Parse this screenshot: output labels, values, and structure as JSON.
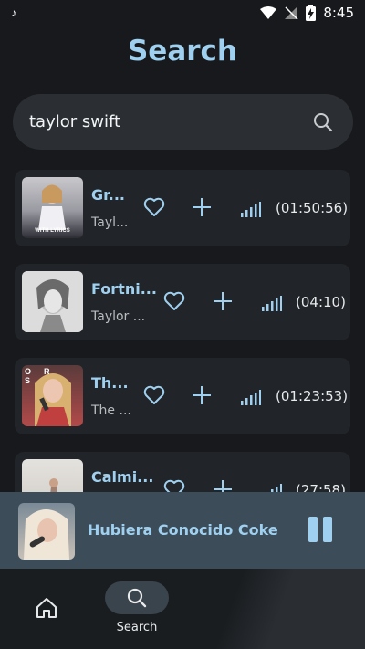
{
  "status": {
    "left_icon": "music-note-icon",
    "time": "8:45"
  },
  "page": {
    "title": "Search"
  },
  "search": {
    "value": "taylor swift"
  },
  "results": [
    {
      "title": "Gr...",
      "artist": "Tayl...",
      "duration": "(01:50:56)",
      "thumb_caption": "WITH LYRICS"
    },
    {
      "title": "Fortni...",
      "artist": "Taylor ...",
      "duration": "(04:10)"
    },
    {
      "title": "Th...",
      "artist": "The ...",
      "duration": "(01:23:53)",
      "thumb_caption": "OR S"
    },
    {
      "title": "Calmi...",
      "artist": "",
      "duration": "(27:58)"
    }
  ],
  "player": {
    "title": "Hubiera Conocido  Coke"
  },
  "nav": {
    "search_label": "Search"
  },
  "colors": {
    "accent": "#9fd0ef",
    "background": "#17191c",
    "card": "#212428",
    "player": "#3c4c59"
  }
}
